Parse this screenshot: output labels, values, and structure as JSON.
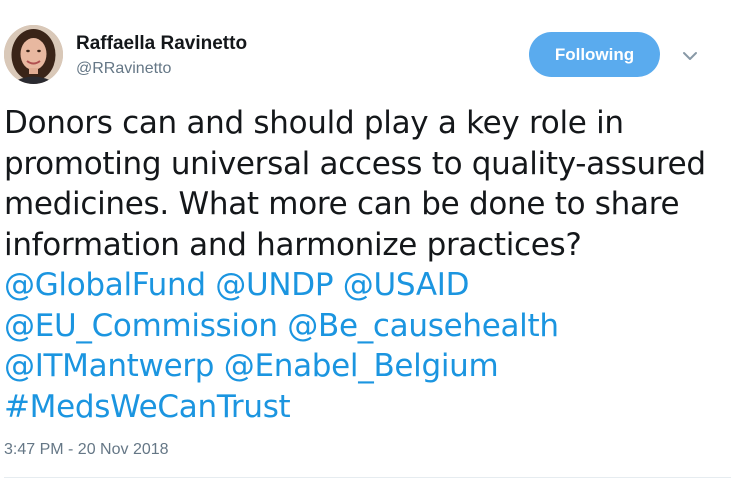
{
  "author": {
    "display_name": "Raffaella Ravinetto",
    "handle": "@RRavinetto"
  },
  "follow_button": {
    "label": "Following",
    "color": "#5aabee"
  },
  "menu_icon": "chevron-down-icon",
  "tweet": {
    "lines": [
      "Donors can and should play a key role in",
      "promoting universal access to quality-assured",
      "medicines. What more can be done to share",
      "information and harmonize practices?"
    ],
    "mentions_line1": [
      "@GlobalFund",
      "@UNDP",
      "@USAID"
    ],
    "mentions_line2": [
      "@EU_Commission",
      "@Be_causehealth"
    ],
    "mentions_line3": [
      "@ITMantwerp",
      "@Enabel_Belgium"
    ],
    "hashtag": "#MedsWeCanTrust",
    "link_color": "#1b95e0"
  },
  "timestamp": "3:47 PM - 20 Nov 2018"
}
